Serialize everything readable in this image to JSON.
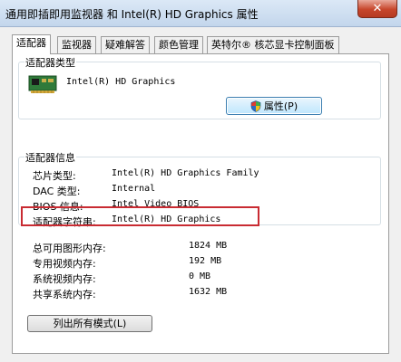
{
  "window": {
    "title": "通用即插即用监视器 和 Intel(R) HD Graphics 属性",
    "close_glyph": "✕"
  },
  "tabs": [
    {
      "label": "适配器",
      "active": true
    },
    {
      "label": "监视器",
      "active": false
    },
    {
      "label": "疑难解答",
      "active": false
    },
    {
      "label": "颜色管理",
      "active": false
    },
    {
      "label": "英特尔® 核芯显卡控制面板",
      "active": false
    }
  ],
  "adapter_type": {
    "title": "适配器类型",
    "name": "Intel(R) HD Graphics",
    "icon": "graphics-card-icon",
    "properties_button": "属性(P)"
  },
  "adapter_info": {
    "title": "适配器信息",
    "rows": [
      {
        "label": "芯片类型:",
        "value": "Intel(R) HD Graphics Family"
      },
      {
        "label": "DAC 类型:",
        "value": "Internal"
      },
      {
        "label": "BIOS 信息:",
        "value": "Intel Video BIOS"
      },
      {
        "label": "适配器字符串:",
        "value": "Intel(R) HD Graphics"
      }
    ]
  },
  "memory": [
    {
      "label": "总可用图形内存:",
      "value": "1824 MB"
    },
    {
      "label": "专用视频内存:",
      "value": "192 MB"
    },
    {
      "label": "系统视频内存:",
      "value": "0 MB"
    },
    {
      "label": "共享系统内存:",
      "value": "1632 MB"
    }
  ],
  "list_modes_button": "列出所有模式(L)",
  "colors": {
    "highlight": "#c92b32",
    "accent": "#3c7fb1"
  }
}
